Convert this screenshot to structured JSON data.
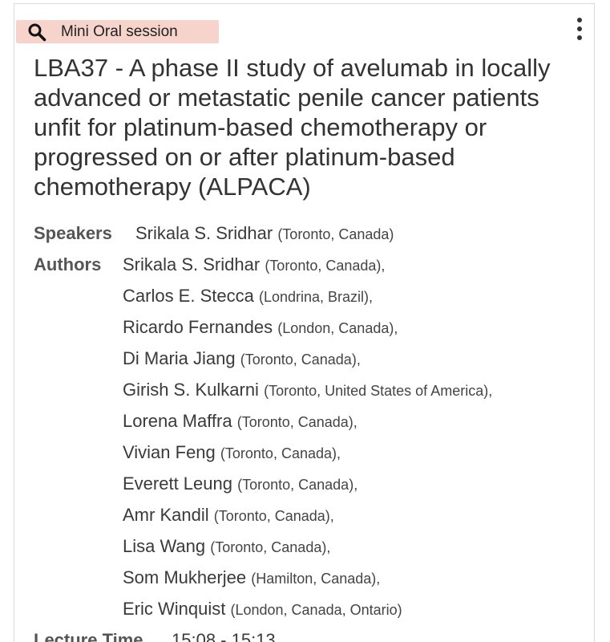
{
  "session": {
    "badge_label": "Mini Oral session",
    "badge_icon": "search-icon",
    "badge_color": "#f6d4cc",
    "more_icon": "vertical-dots-icon"
  },
  "abstract": {
    "title": "LBA37 - A phase II study of avelumab in locally advanced or metastatic penile cancer patients unfit for platinum-based chemotherapy or progressed on or after platinum-based chemotherapy (ALPACA)"
  },
  "speakers": {
    "label": "Speakers",
    "items": [
      {
        "name": "Srikala S. Sridhar",
        "affiliation": "(Toronto, Canada)"
      }
    ]
  },
  "authors": {
    "label": "Authors",
    "items": [
      {
        "name": "Srikala S. Sridhar",
        "affiliation": "(Toronto, Canada),"
      },
      {
        "name": "Carlos E. Stecca",
        "affiliation": "(Londrina, Brazil),"
      },
      {
        "name": "Ricardo Fernandes",
        "affiliation": "(London, Canada),"
      },
      {
        "name": "Di Maria Jiang",
        "affiliation": "(Toronto, Canada),"
      },
      {
        "name": "Girish S. Kulkarni",
        "affiliation": "(Toronto, United States of America),"
      },
      {
        "name": "Lorena Maffra",
        "affiliation": "(Toronto, Canada),"
      },
      {
        "name": "Vivian Feng",
        "affiliation": "(Toronto, Canada),"
      },
      {
        "name": "Everett Leung",
        "affiliation": "(Toronto, Canada),"
      },
      {
        "name": "Amr Kandil",
        "affiliation": "(Toronto, Canada),"
      },
      {
        "name": "Lisa Wang",
        "affiliation": "(Toronto, Canada),"
      },
      {
        "name": "Som Mukherjee",
        "affiliation": "(Hamilton, Canada),"
      },
      {
        "name": "Eric Winquist",
        "affiliation": "(London, Canada, Ontario)"
      }
    ]
  },
  "lecture": {
    "label": "Lecture Time",
    "time": "15:08 - 15:13"
  }
}
